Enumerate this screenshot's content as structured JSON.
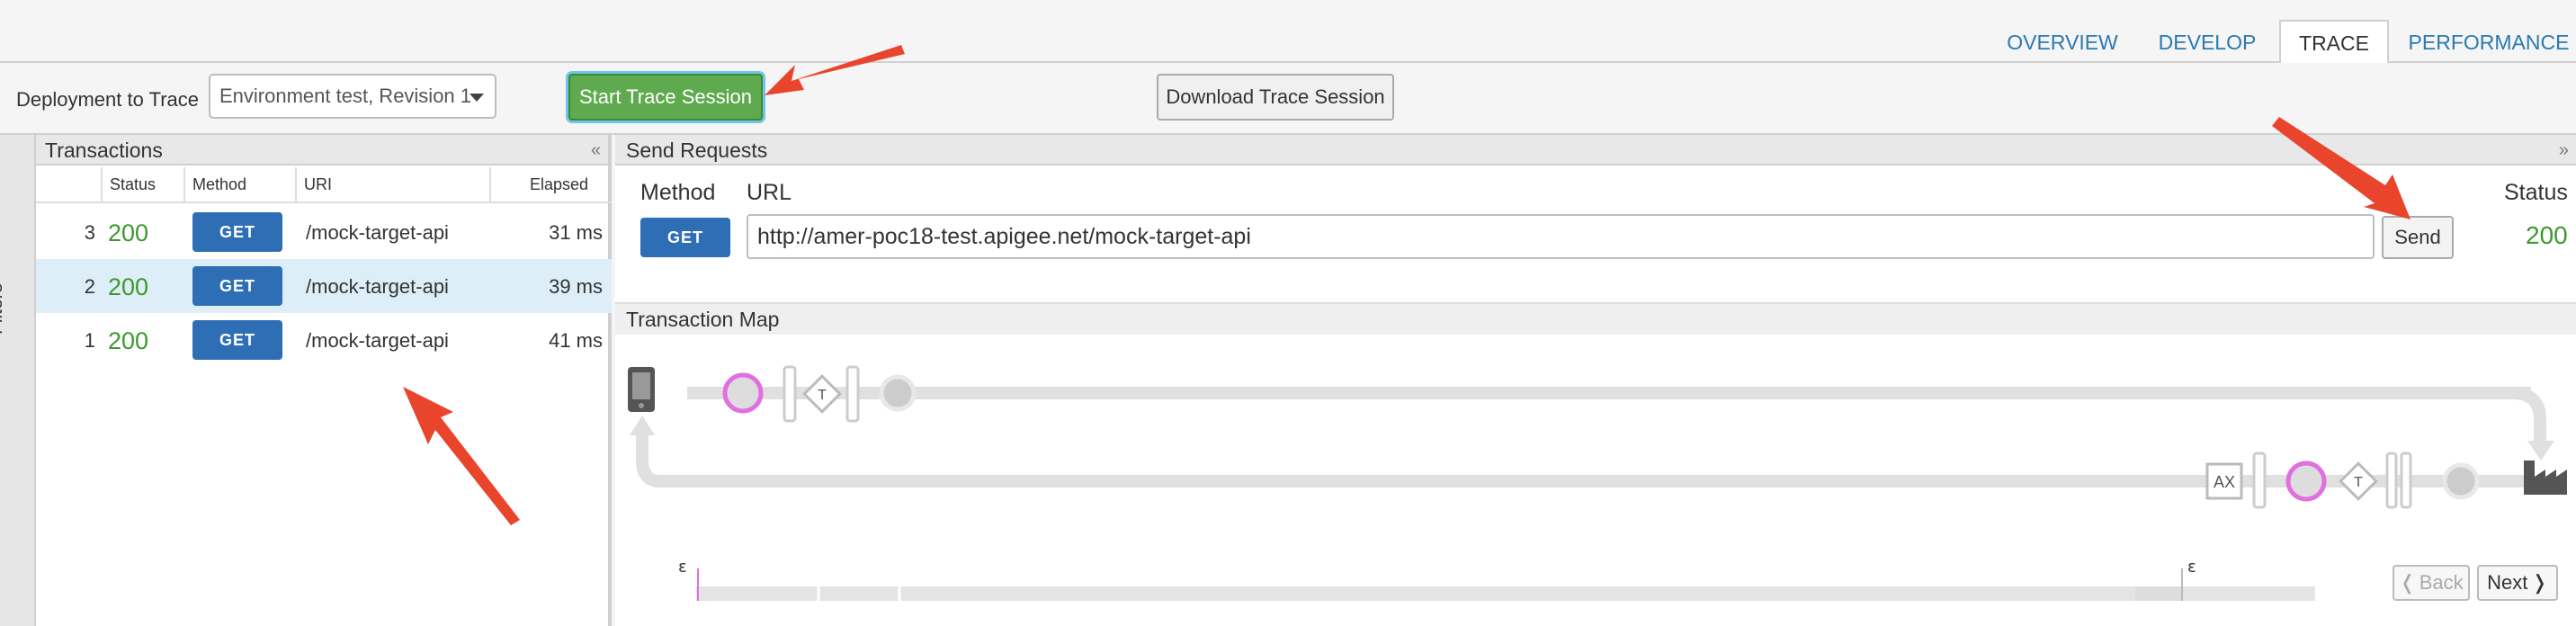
{
  "tabs": [
    "OVERVIEW",
    "DEVELOP",
    "TRACE",
    "PERFORMANCE"
  ],
  "active_tab": "TRACE",
  "toolbar": {
    "deploy_label": "Deployment to Trace",
    "deploy_value": "Environment test, Revision 1",
    "start_label": "Start Trace Session",
    "download_label": "Download Trace Session"
  },
  "filters_label": "Filters",
  "transactions": {
    "title": "Transactions",
    "collapse_icon": "«",
    "columns": [
      "Status",
      "Method",
      "URI",
      "Elapsed"
    ],
    "rows": [
      {
        "num": "3",
        "status": "200",
        "method": "GET",
        "uri": "/mock-target-api",
        "elapsed": "31 ms"
      },
      {
        "num": "2",
        "status": "200",
        "method": "GET",
        "uri": "/mock-target-api",
        "elapsed": "39 ms"
      },
      {
        "num": "1",
        "status": "200",
        "method": "GET",
        "uri": "/mock-target-api",
        "elapsed": "41 ms"
      }
    ]
  },
  "send": {
    "title": "Send Requests",
    "method_label": "Method",
    "url_label": "URL",
    "status_label": "Status",
    "method": "GET",
    "url": "http://amer-poc18-test.apigee.net/mock-target-api",
    "send_label": "Send",
    "status": "200"
  },
  "map": {
    "title": "Transaction Map",
    "step_t": "T",
    "step_ax": "AX",
    "epsilon": "ε"
  },
  "nav": {
    "back": "Back",
    "next": "Next",
    "back_icon": "❬",
    "next_icon": "❭"
  },
  "colors": {
    "accent": "#2a7ab0",
    "success": "#3c9a2d",
    "button_blue": "#2e6eb5",
    "start_green": "#5fa94e",
    "arrow": "#e8452c",
    "policy_pink": "#e070e0"
  }
}
